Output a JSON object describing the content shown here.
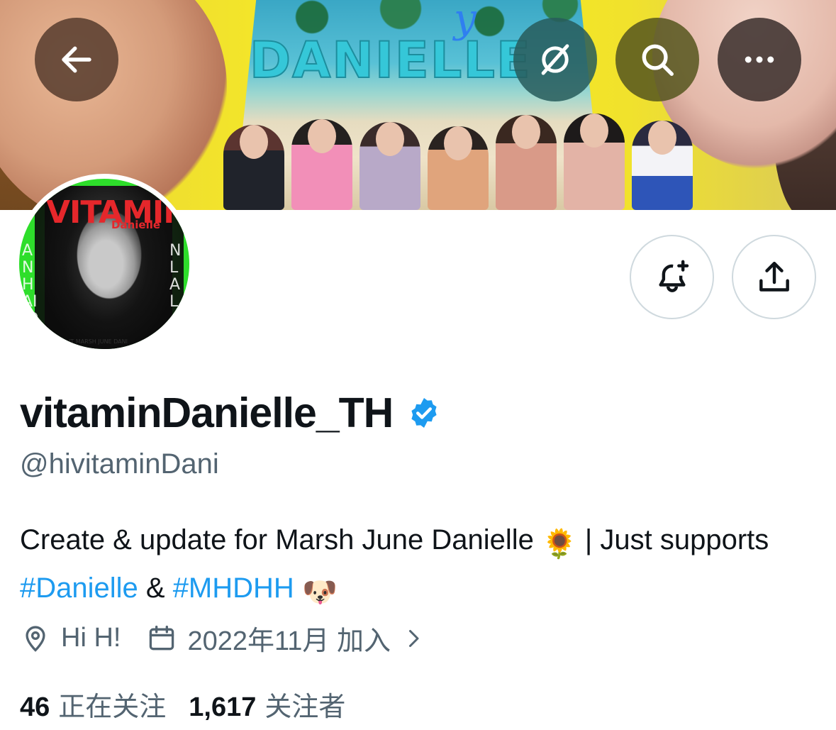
{
  "banner": {
    "title": "DANIELLE",
    "script_text": "y"
  },
  "top_bar": {
    "back_icon": "arrow-left-icon",
    "grok_icon": "grok-icon",
    "search_icon": "search-icon",
    "more_icon": "more-horizontal-icon"
  },
  "avatar": {
    "main_text": "VITAMIN",
    "sub_text": "Danielle",
    "side_left": "ANHAIJDAIL",
    "side_right": "NLAL",
    "footer_text": "IT MARSH JUNE DANI"
  },
  "actions": {
    "notify_icon": "bell-plus-icon",
    "share_icon": "share-upload-icon"
  },
  "profile": {
    "display_name": "vitaminDanielle_TH",
    "verified_icon": "verified-badge-icon",
    "handle": "@hivitaminDani",
    "bio_part1": "Create & update for Marsh June Danielle ",
    "bio_emoji1": "🌻",
    "bio_part2": " | Just supports ",
    "bio_hashtag1": "#Danielle",
    "bio_part3": " & ",
    "bio_hashtag2": "#MHDHH",
    "bio_emoji2": "🐶",
    "location": "Hi H!",
    "joined": "2022年11月 加入",
    "following_count": "46",
    "following_label": "正在关注",
    "followers_count": "1,617",
    "followers_label": "关注者"
  },
  "colors": {
    "accent": "#1d9bf0",
    "text_primary": "#0f1419",
    "text_secondary": "#536471",
    "border": "#cfd9de"
  }
}
